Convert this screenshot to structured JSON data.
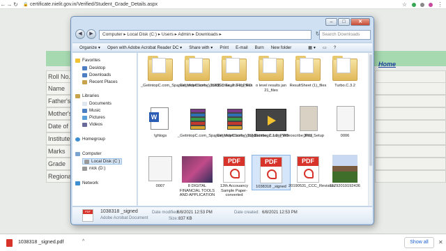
{
  "browser": {
    "url": "certificate.nielit.gov.in/Verified/Student_Grade_Details.aspx"
  },
  "site": {
    "home_link": "Home",
    "fields": [
      "Roll No.",
      "Name",
      "Father's",
      "Mother's",
      "Date of",
      "Institute",
      "Marks",
      "Grade",
      "Regional"
    ]
  },
  "explorer": {
    "address": "Computer  ▸  Local Disk (C:)  ▸  Users  ▸  Admin  ▸  Downloads  ▸",
    "search_placeholder": "Search Downloads",
    "toolbar": [
      "Organize ▾",
      "Open with Adobe Acrobat Reader DC ▾",
      "Share with ▾",
      "Print",
      "E-mail",
      "Burn",
      "New folder"
    ],
    "nav": {
      "favorites": "Favorites",
      "desktop": "Desktop",
      "downloads": "Downloads",
      "recent": "Recent Places",
      "libraries": "Libraries",
      "documents": "Documents",
      "music": "Music",
      "pictures": "Pictures",
      "videos": "Videos",
      "homegroup": "Homegroup",
      "computer": "Computer",
      "localdisk": "Local Disk (C:)",
      "nick": "nick (D:)",
      "network": "Network"
    },
    "files": [
      {
        "label": "_GetintopC.com_Sparkol_VideoScribe_3.2.1",
        "kind": "folder"
      },
      {
        "label": "_GetintopC.com_VideoScribe_2.1.0_PRO",
        "kind": "folder"
      },
      {
        "label": "CCC Exam Feb_files",
        "kind": "folder"
      },
      {
        "label": "o level results jan 21_files",
        "kind": "folder"
      },
      {
        "label": "ResultSheet (1)_files",
        "kind": "folder"
      },
      {
        "label": "Turbo.C.3.2",
        "kind": "folder"
      },
      {
        "label": "!ghlogs",
        "kind": "word"
      },
      {
        "label": "_GetintopC.com_Sparkol_VideoScribe_3.2.1",
        "kind": "rar"
      },
      {
        "label": "_GetintopC.com_VideoScribe_2.1.0_PRO",
        "kind": "rar"
      },
      {
        "label": "_GetintopC.com_Videoscribe_Pro_Setup",
        "kind": "video"
      },
      {
        "label": "0003",
        "kind": "doc"
      },
      {
        "label": "0006",
        "kind": "doc"
      },
      {
        "label": "0007",
        "kind": "doc"
      },
      {
        "label": "8 DIGITAL FINANCIAL TOOLS AND APPLICATION",
        "kind": "image"
      },
      {
        "label": "12th Accouancy Sample Paper-converted",
        "kind": "pdf"
      },
      {
        "label": "1038318 _signed",
        "kind": "pdf",
        "selected": true
      },
      {
        "label": "20190531_CCC_Revision",
        "kind": "pdf"
      },
      {
        "label": "11292019192436",
        "kind": "photo"
      }
    ],
    "details": {
      "name": "1038318 _signed",
      "type": "Adobe Acrobat Document",
      "modified_label": "Date modified:",
      "modified": "6/8/2021 12:53 PM",
      "created_label": "Date created:",
      "created": "6/8/2021 12:53 PM",
      "size_label": "Size:",
      "size": "837 KB"
    }
  },
  "shelf": {
    "filename": "1038318 _signed.pdf",
    "show_all": "Show all"
  }
}
